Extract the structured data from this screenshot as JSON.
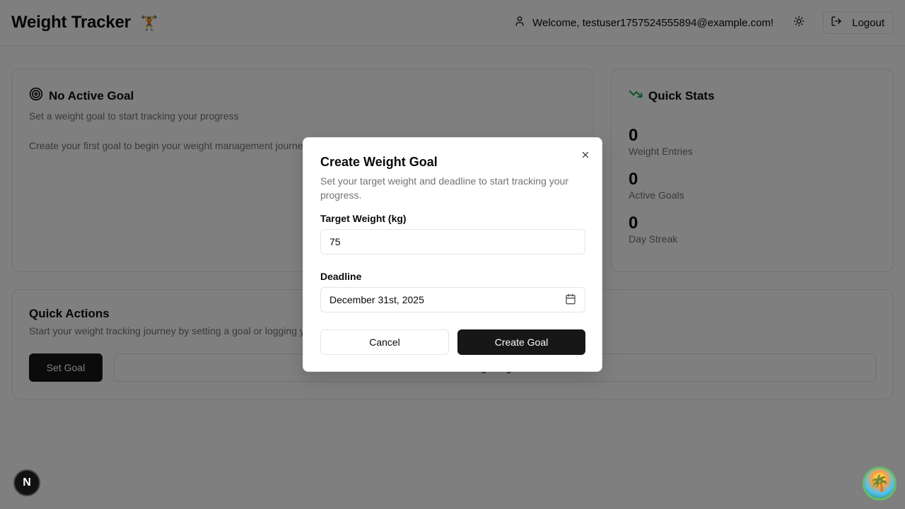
{
  "header": {
    "title": "Weight Tracker",
    "emoji": "🏋️",
    "welcome": "Welcome, testuser1757524555894@example.com!",
    "logout_label": "Logout"
  },
  "goal_card": {
    "title": "No Active Goal",
    "subtitle": "Set a weight goal to start tracking your progress",
    "body": "Create your first goal to begin your weight management journey"
  },
  "stats_card": {
    "title": "Quick Stats",
    "stats": [
      {
        "value": "0",
        "label": "Weight Entries"
      },
      {
        "value": "0",
        "label": "Active Goals"
      },
      {
        "value": "0",
        "label": "Day Streak"
      }
    ]
  },
  "actions_card": {
    "title": "Quick Actions",
    "subtitle": "Start your weight tracking journey by setting a goal or logging your weight",
    "set_goal_label": "Set Goal",
    "log_weight_label": "Log Weight"
  },
  "dialog": {
    "title": "Create Weight Goal",
    "description": "Set your target weight and deadline to start tracking your progress.",
    "target_label": "Target Weight (kg)",
    "target_value": "75",
    "deadline_label": "Deadline",
    "deadline_value": "December 31st, 2025",
    "cancel_label": "Cancel",
    "create_label": "Create Goal"
  },
  "badge": {
    "letter": "N"
  },
  "colors": {
    "accent_dark": "#171717",
    "trend_green": "#16a34a"
  }
}
